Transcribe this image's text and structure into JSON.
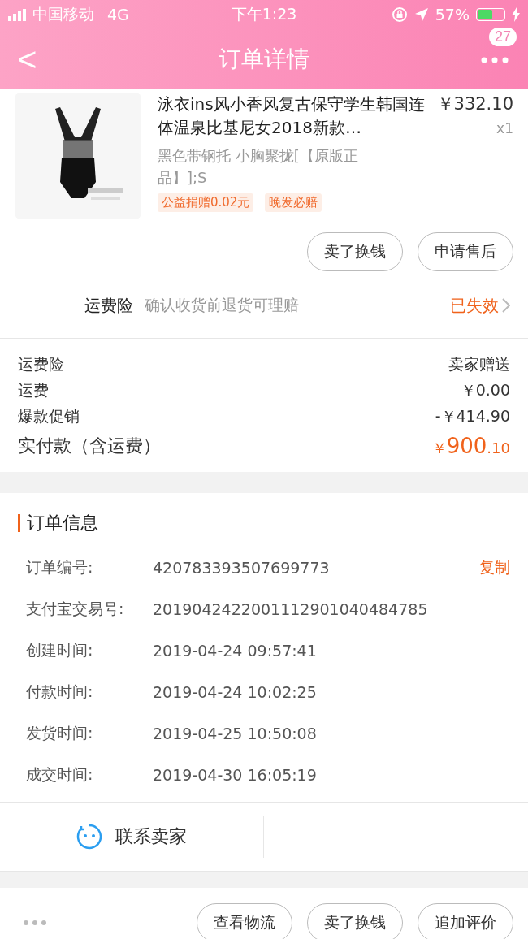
{
  "status_bar": {
    "carrier": "中国移动",
    "network": "4G",
    "time": "下午1:23",
    "battery_text": "57%"
  },
  "nav": {
    "back": "<",
    "title": "订单详情",
    "badge": "27"
  },
  "product": {
    "image": {
      "kind": "picture"
    },
    "title": "泳衣ins风小香风复古保守学生韩国连体温泉比基尼女2018新款…",
    "price": "￥332.10",
    "quantity": "x1",
    "sku": "黑色带钢托 小胸聚拢[【原版正品】];S",
    "tags": [
      "公益捐赠0.02元",
      "晚发必赔"
    ]
  },
  "item_actions": [
    "卖了换钱",
    "申请售后"
  ],
  "insurance": {
    "label": "运费险",
    "description": "确认收货前退货可理赔",
    "status": "已失效"
  },
  "fees": [
    {
      "label": "运费险",
      "value": "卖家赠送"
    },
    {
      "label": "运费",
      "value": "￥0.00"
    },
    {
      "label": "爆款促销",
      "value": "-￥414.90"
    }
  ],
  "total": {
    "label": "实付款（含运费）",
    "currency": "￥",
    "integer": "900",
    "decimal": ".10"
  },
  "order_info": {
    "title": "订单信息",
    "rows": [
      {
        "label": "订单编号:",
        "value": "420783393507699773",
        "action": "复制"
      },
      {
        "label": "支付宝交易号:",
        "value": "2019042422001112901040484785"
      },
      {
        "label": "创建时间:",
        "value": "2019-04-24 09:57:41"
      },
      {
        "label": "付款时间:",
        "value": "2019-04-24 10:02:25"
      },
      {
        "label": "发货时间:",
        "value": "2019-04-25 10:50:08"
      },
      {
        "label": "成交时间:",
        "value": "2019-04-30 16:05:19"
      }
    ]
  },
  "contact": {
    "label": "联系卖家"
  },
  "bottom_actions": [
    "查看物流",
    "卖了换钱",
    "追加评价"
  ]
}
